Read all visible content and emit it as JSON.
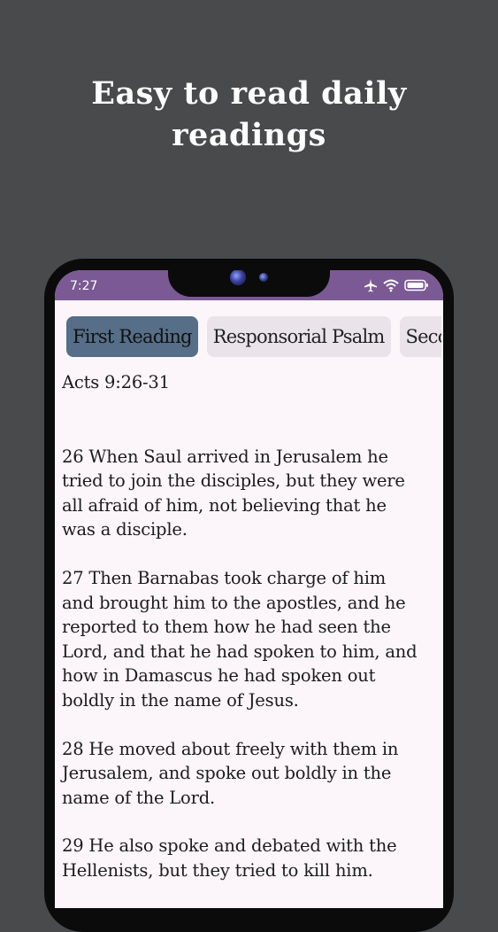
{
  "promo": {
    "headline_line1": "Easy to read daily",
    "headline_line2": "readings"
  },
  "status_bar": {
    "time": "7:27",
    "icons": [
      "airplane-icon",
      "wifi-icon",
      "battery-icon"
    ]
  },
  "tabs": [
    {
      "label": "First Reading",
      "active": true
    },
    {
      "label": "Responsorial Psalm",
      "active": false
    },
    {
      "label": "Second Reading",
      "active": false
    }
  ],
  "reading": {
    "citation": "Acts 9:26-31",
    "verses": [
      [
        "26 When Saul arrived in Jerusalem he",
        "tried to join the disciples, but they were",
        "all afraid of him, not believing that he",
        "was a disciple."
      ],
      [
        "27 Then Barnabas took charge of him",
        "and brought him to the apostles, and he",
        "reported to them how he had seen the",
        "Lord, and that he had spoken to him, and",
        "how in Damascus he had spoken out",
        "boldly in the name of Jesus."
      ],
      [
        "28 He moved about freely with them in",
        "Jerusalem, and spoke out boldly in the",
        "name of the Lord."
      ],
      [
        "29 He also spoke and debated with the",
        "Hellenists, but they tried to kill him."
      ]
    ]
  },
  "colors": {
    "background": "#484a4b",
    "status_bar": "#7a5994",
    "screen": "#fcf6fb",
    "tab_active": "#566e87",
    "tab_inactive": "#ebe3ea"
  }
}
